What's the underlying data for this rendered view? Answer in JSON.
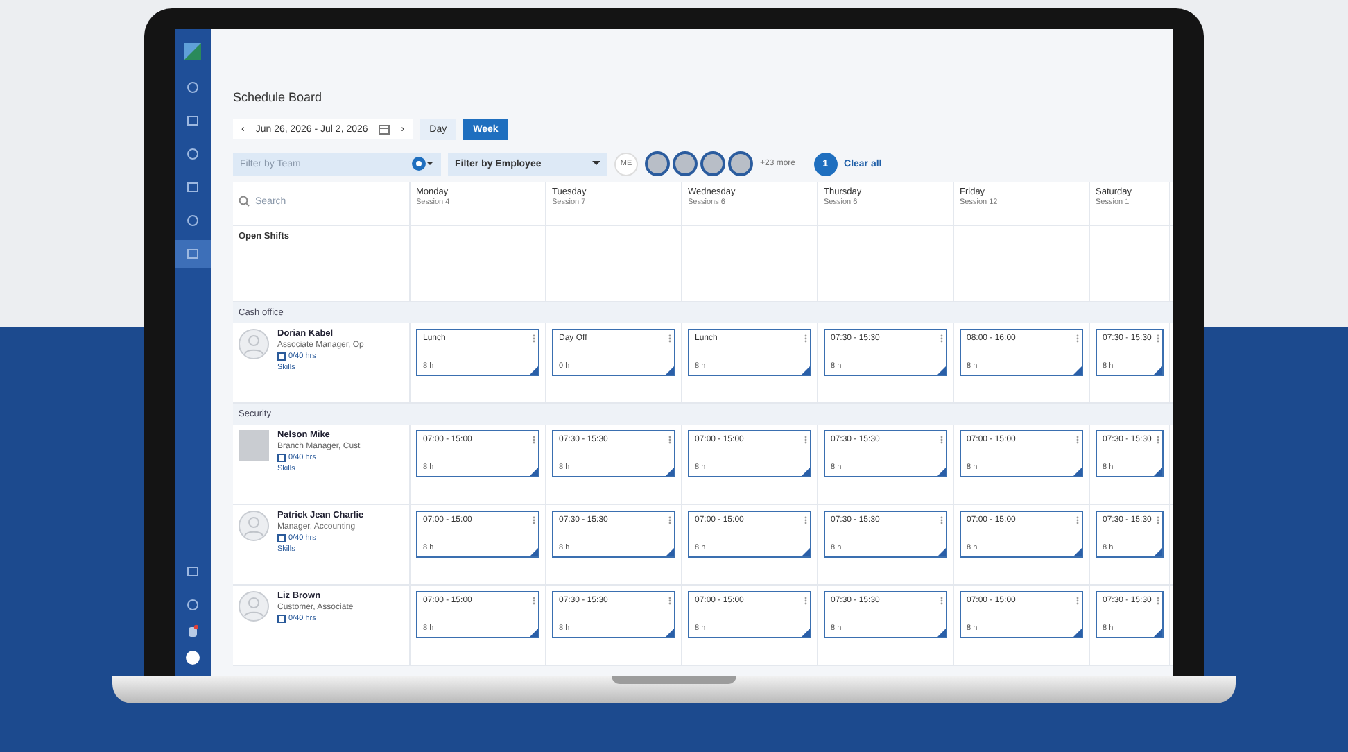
{
  "app": {
    "title": "Schedule Board"
  },
  "sidebar": {
    "items": [
      {
        "selected": false
      },
      {
        "selected": false
      },
      {
        "selected": false
      },
      {
        "selected": false
      },
      {
        "selected": false
      },
      {
        "selected": true
      }
    ]
  },
  "toolbar": {
    "prev": "‹",
    "date_range": "Jun 26, 2026 - Jul 2, 2026",
    "next": "›",
    "views": [
      {
        "label": "Day",
        "selected": false
      },
      {
        "label": "Week",
        "selected": true
      }
    ]
  },
  "filters": {
    "team": {
      "placeholder": "Filter by Team"
    },
    "employee": {
      "value": "Filter by Employee"
    },
    "me": "ME",
    "more": "+23 more",
    "count": "1",
    "clear": "Clear all"
  },
  "schedule": {
    "search": {
      "placeholder": "Search"
    },
    "days": [
      {
        "name": "Monday",
        "sub": "Session 4"
      },
      {
        "name": "Tuesday",
        "sub": "Session 7"
      },
      {
        "name": "Wednesday",
        "sub": "Sessions 6"
      },
      {
        "name": "Thursday",
        "sub": "Session 6"
      },
      {
        "name": "Friday",
        "sub": "Session 12"
      },
      {
        "name": "Saturday",
        "sub": "Session 1"
      }
    ],
    "open_shifts": "Open Shifts",
    "groups": [
      {
        "name": "Cash office",
        "employees": [
          {
            "name": "Dorian Kabel",
            "role": "Associate Manager, Op",
            "hours": "0/40 hrs",
            "skills": "Skills",
            "kind": "silhouette",
            "shifts": [
              {
                "time": "Lunch",
                "hours": "8 h"
              },
              {
                "time": "Day Off",
                "hours": "0 h"
              },
              {
                "time": "Lunch",
                "hours": "8 h"
              },
              {
                "time": "07:30 - 15:30",
                "hours": "8 h"
              },
              {
                "time": "08:00 - 16:00",
                "hours": "8 h"
              },
              {
                "time": "07:30 - 15:30",
                "hours": "8 h"
              }
            ]
          }
        ]
      },
      {
        "name": "Security",
        "employees": [
          {
            "name": "Nelson Mike",
            "role": "Branch Manager, Cust",
            "hours": "0/40 hrs",
            "skills": "Skills",
            "kind": "photo",
            "shifts": [
              {
                "time": "07:00 - 15:00",
                "hours": "8 h"
              },
              {
                "time": "07:30 - 15:30",
                "hours": "8 h"
              },
              {
                "time": "07:00 - 15:00",
                "hours": "8 h"
              },
              {
                "time": "07:30 - 15:30",
                "hours": "8 h"
              },
              {
                "time": "07:00 - 15:00",
                "hours": "8 h"
              },
              {
                "time": "07:30 - 15:30",
                "hours": "8 h"
              }
            ]
          },
          {
            "name": "Patrick Jean Charlie",
            "role": "Manager, Accounting",
            "hours": "0/40 hrs",
            "skills": "Skills",
            "kind": "silhouette",
            "shifts": [
              {
                "time": "07:00 - 15:00",
                "hours": "8 h"
              },
              {
                "time": "07:30 - 15:30",
                "hours": "8 h"
              },
              {
                "time": "07:00 - 15:00",
                "hours": "8 h"
              },
              {
                "time": "07:30 - 15:30",
                "hours": "8 h"
              },
              {
                "time": "07:00 - 15:00",
                "hours": "8 h"
              },
              {
                "time": "07:30 - 15:30",
                "hours": "8 h"
              }
            ]
          },
          {
            "name": "Liz Brown",
            "role": "Customer, Associate",
            "hours": "0/40 hrs",
            "kind": "silhouette",
            "shifts": [
              {
                "time": "07:00 - 15:00",
                "hours": "8 h"
              },
              {
                "time": "07:30 - 15:30",
                "hours": "8 h"
              },
              {
                "time": "07:00 - 15:00",
                "hours": "8 h"
              },
              {
                "time": "07:30 - 15:30",
                "hours": "8 h"
              },
              {
                "time": "07:00 - 15:00",
                "hours": "8 h"
              },
              {
                "time": "07:30 - 15:30",
                "hours": "8 h"
              }
            ]
          }
        ]
      }
    ]
  }
}
